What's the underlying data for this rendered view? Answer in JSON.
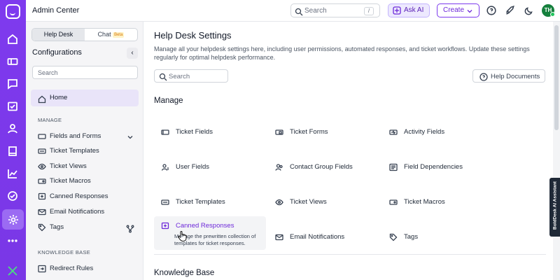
{
  "app": {
    "title": "Admin Center",
    "avatar": "TH"
  },
  "topbar": {
    "search_placeholder": "Search",
    "search_shortcut": "/",
    "ask_ai": "Ask AI",
    "create": "Create"
  },
  "sidebar": {
    "tabs": [
      {
        "label": "Help Desk"
      },
      {
        "label": "Chat",
        "badge": "Beta"
      }
    ],
    "heading": "Configurations",
    "search_placeholder": "Search",
    "home": "Home",
    "manage_section": "MANAGE",
    "items": [
      "Fields and Forms",
      "Ticket Templates",
      "Ticket Views",
      "Ticket Macros",
      "Canned Responses",
      "Email Notifications",
      "Tags"
    ],
    "kb_section": "KNOWLEDGE BASE",
    "kb_items": [
      "Redirect Rules"
    ]
  },
  "main": {
    "title": "Help Desk Settings",
    "description": "Manage all your helpdesk settings here, including user permissions, automated responses, and ticket workflows. Update these settings regularly for optimal helpdesk performance.",
    "search_placeholder": "Search",
    "help_docs": "Help Documents",
    "manage_heading": "Manage",
    "cards": [
      {
        "label": "Ticket Fields",
        "icon": "ticket-fields-icon"
      },
      {
        "label": "Ticket Forms",
        "icon": "ticket-forms-icon"
      },
      {
        "label": "Activity Fields",
        "icon": "activity-fields-icon"
      },
      {
        "label": "User Fields",
        "icon": "user-fields-icon"
      },
      {
        "label": "Contact Group Fields",
        "icon": "contact-group-icon"
      },
      {
        "label": "Field Dependencies",
        "icon": "field-dependencies-icon"
      },
      {
        "label": "Ticket Templates",
        "icon": "ticket-templates-icon"
      },
      {
        "label": "Ticket Views",
        "icon": "eye-icon"
      },
      {
        "label": "Ticket Macros",
        "icon": "ticket-macros-icon"
      },
      {
        "label": "Canned Responses",
        "icon": "canned-responses-icon",
        "description": "Manage the prewritten collection of templates for ticket responses."
      },
      {
        "label": "Email Notifications",
        "icon": "email-icon"
      },
      {
        "label": "Tags",
        "icon": "tag-icon"
      }
    ],
    "kb_heading": "Knowledge Base"
  },
  "assistant": "BoldDesk AI Assistant",
  "colors": {
    "brand": "#7c3aed",
    "active_nav": "#e9e4f9"
  }
}
